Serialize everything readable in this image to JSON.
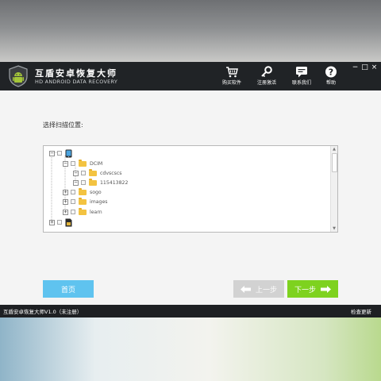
{
  "app": {
    "title": "互盾安卓恢复大师",
    "subtitle": "HD ANDROID DATA RECOVERY"
  },
  "toolbar": {
    "buy": {
      "label": "购买软件",
      "icon": "cart-icon"
    },
    "register": {
      "label": "注册激活",
      "icon": "key-icon"
    },
    "contact": {
      "label": "联系我们",
      "icon": "chat-icon"
    },
    "help": {
      "label": "帮助",
      "icon": "help-icon"
    }
  },
  "window_controls": {
    "minimize": "−",
    "restore": "□",
    "close": "×"
  },
  "main": {
    "prompt": "选择扫描位置:",
    "tree": {
      "nodes": [
        {
          "label": "",
          "icon": "phone-icon",
          "expander": "−"
        },
        {
          "label": "DCIM",
          "icon": "folder-icon",
          "expander": "−"
        },
        {
          "label": "cdvscscs",
          "icon": "folder-icon",
          "expander": "−"
        },
        {
          "label": "115413822",
          "icon": "folder-icon",
          "expander": "−"
        },
        {
          "label": "sogo",
          "icon": "folder-icon",
          "expander": "+"
        },
        {
          "label": "images",
          "icon": "folder-icon",
          "expander": "+"
        },
        {
          "label": "learn",
          "icon": "folder-icon",
          "expander": "+"
        },
        {
          "label": "",
          "icon": "sd-card-icon",
          "expander": "+"
        }
      ]
    }
  },
  "buttons": {
    "home": "首页",
    "prev": "上一步",
    "next": "下一步"
  },
  "status": {
    "version": "互盾安卓恢复大师V1.0（未注册）",
    "check_update": "检查更新"
  },
  "colors": {
    "titlebar": "#202326",
    "home_button": "#5fc3ef",
    "prev_button_disabled": "#d2d2d2",
    "next_button": "#7ed21f",
    "folder": "#f3c341"
  }
}
